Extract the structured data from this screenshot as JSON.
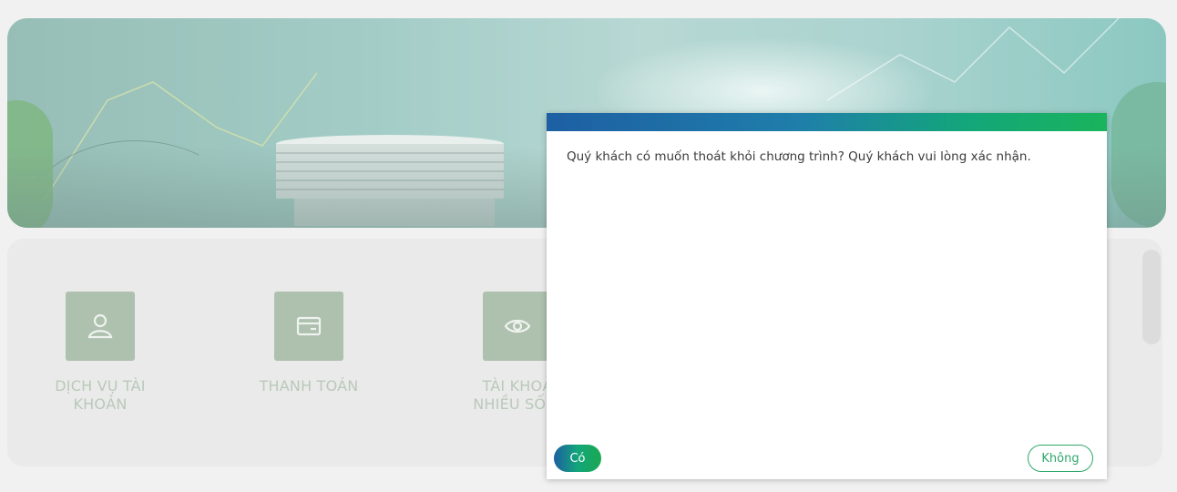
{
  "menu": {
    "items": [
      {
        "label": "DỊCH VỤ TÀI\nKHOẢN",
        "icon": "user-icon"
      },
      {
        "label": "THANH TOÁN",
        "icon": "card-icon"
      },
      {
        "label": "TÀI KHOẢ\nNHIỀU SỐ H",
        "icon": "eye-icon"
      }
    ]
  },
  "dialog": {
    "message": "Quý khách có muốn thoát khỏi chương trình? Quý khách vui lòng xác nhận.",
    "yes_label": "Có",
    "no_label": "Không"
  },
  "colors": {
    "header_gradient_start": "#1d5fa3",
    "header_gradient_end": "#19b45c",
    "accent_green": "#2ea86a",
    "tile_green": "#8fa88f"
  }
}
